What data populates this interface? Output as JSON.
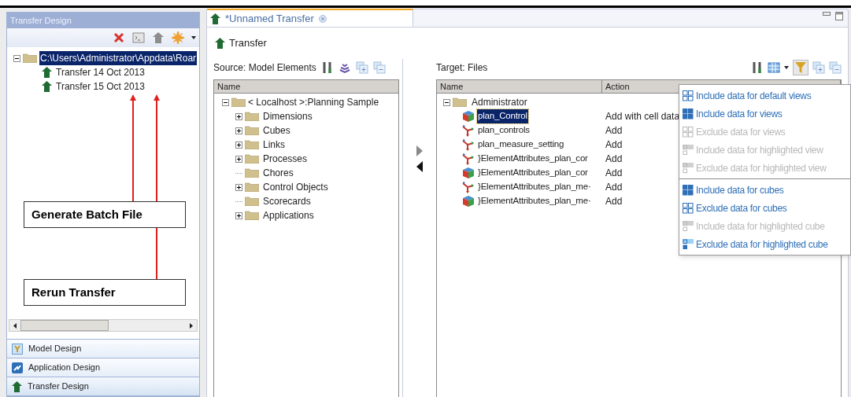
{
  "left_panel": {
    "title": "Transfer Design",
    "tree": [
      {
        "label": "C:\\Users\\Administrator\\Appdata\\Roar",
        "kind": "folder",
        "selected": true,
        "expanded": true,
        "children": [
          {
            "label": "Transfer 14 Oct 2013",
            "kind": "transfer",
            "selected": false
          },
          {
            "label": "Transfer 15 Oct 2013",
            "kind": "transfer",
            "selected": false
          }
        ]
      }
    ],
    "callouts": [
      {
        "label": "Generate Batch File"
      },
      {
        "label": "Rerun Transfer"
      }
    ],
    "nav": [
      {
        "label": "Model Design",
        "kind": "model",
        "selected": false
      },
      {
        "label": "Application Design",
        "kind": "application",
        "selected": false
      },
      {
        "label": "Transfer Design",
        "kind": "transfer",
        "selected": true
      }
    ]
  },
  "editor_tab": {
    "title": "*Unnamed Transfer",
    "selected": true
  },
  "heading": "Transfer",
  "source": {
    "title": "Source: Model Elements",
    "columns": [
      "Name"
    ],
    "tree": [
      {
        "label": "< Localhost >:Planning Sample",
        "expanded": true,
        "children": [
          {
            "label": "Dimensions",
            "expandable": true
          },
          {
            "label": "Cubes",
            "expandable": true
          },
          {
            "label": "Links",
            "expandable": true
          },
          {
            "label": "Processes",
            "expandable": true
          },
          {
            "label": "Chores",
            "expandable": false
          },
          {
            "label": "Control Objects",
            "expandable": true
          },
          {
            "label": "Scorecards",
            "expandable": false
          },
          {
            "label": "Applications",
            "expandable": true
          }
        ]
      }
    ]
  },
  "target": {
    "title": "Target: Files",
    "columns": [
      "Name",
      "Action"
    ],
    "folder": {
      "label": "Administrator",
      "expanded": true
    },
    "rows": [
      {
        "name": "plan_Control",
        "action": "Add with cell data",
        "kind": "cube",
        "selected": true
      },
      {
        "name": "plan_controls",
        "action": "Add",
        "kind": "dimension",
        "selected": false
      },
      {
        "name": "plan_measure_setting",
        "action": "Add",
        "kind": "dimension",
        "selected": false
      },
      {
        "name": "}ElementAttributes_plan_cor",
        "action": "Add",
        "kind": "dimension",
        "selected": false
      },
      {
        "name": "}ElementAttributes_plan_cor",
        "action": "Add",
        "kind": "cube",
        "selected": false
      },
      {
        "name": "}ElementAttributes_plan_me·",
        "action": "Add",
        "kind": "dimension",
        "selected": false
      },
      {
        "name": "}ElementAttributes_plan_me·",
        "action": "Add",
        "kind": "cube",
        "selected": false
      }
    ]
  },
  "filter_menu": [
    [
      {
        "label": "Include data for default views",
        "disabled": false,
        "kind": "empty"
      },
      {
        "label": "Include data for views",
        "disabled": false,
        "kind": "checked"
      },
      {
        "label": "Exclude data for views",
        "disabled": true,
        "kind": "empty"
      },
      {
        "label": "Include data for highlighted view",
        "disabled": true,
        "kind": "highlight"
      },
      {
        "label": "Exclude data for highlighted view",
        "disabled": true,
        "kind": "highlight"
      }
    ],
    [
      {
        "label": "Include data for cubes",
        "disabled": false,
        "kind": "checked"
      },
      {
        "label": "Exclude data for cubes",
        "disabled": false,
        "kind": "empty"
      },
      {
        "label": "Include data for highlighted cube",
        "disabled": true,
        "kind": "highlight"
      },
      {
        "label": "Exclude data for highlighted cube",
        "disabled": false,
        "kind": "highlight"
      }
    ]
  ]
}
